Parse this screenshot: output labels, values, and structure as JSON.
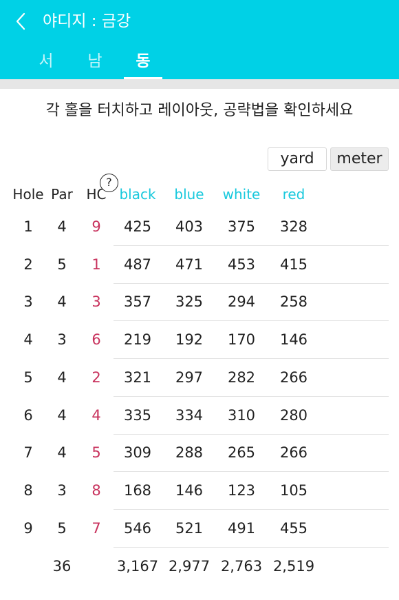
{
  "header": {
    "title": "야디지 : 금강",
    "back_icon": "chevron-left-icon",
    "tabs": [
      {
        "label": "서",
        "active": false
      },
      {
        "label": "남",
        "active": false
      },
      {
        "label": "동",
        "active": true
      }
    ],
    "background_color": "#00d1e6"
  },
  "instruction": "각 홀을 터치하고 레이아웃, 공략법을 확인하세요",
  "units": {
    "yard_label": "yard",
    "meter_label": "meter"
  },
  "table": {
    "columns": {
      "hole": "Hole",
      "par": "Par",
      "hc": "HC",
      "help_icon_label": "?",
      "black": "black",
      "blue": "blue",
      "white": "white",
      "red": "red"
    },
    "rows": [
      {
        "hole": "1",
        "par": "4",
        "hc": "9",
        "black": "425",
        "blue": "403",
        "white": "375",
        "red": "328"
      },
      {
        "hole": "2",
        "par": "5",
        "hc": "1",
        "black": "487",
        "blue": "471",
        "white": "453",
        "red": "415"
      },
      {
        "hole": "3",
        "par": "4",
        "hc": "3",
        "black": "357",
        "blue": "325",
        "white": "294",
        "red": "258"
      },
      {
        "hole": "4",
        "par": "3",
        "hc": "6",
        "black": "219",
        "blue": "192",
        "white": "170",
        "red": "146"
      },
      {
        "hole": "5",
        "par": "4",
        "hc": "2",
        "black": "321",
        "blue": "297",
        "white": "282",
        "red": "266"
      },
      {
        "hole": "6",
        "par": "4",
        "hc": "4",
        "black": "335",
        "blue": "334",
        "white": "310",
        "red": "280"
      },
      {
        "hole": "7",
        "par": "4",
        "hc": "5",
        "black": "309",
        "blue": "288",
        "white": "265",
        "red": "266"
      },
      {
        "hole": "8",
        "par": "3",
        "hc": "8",
        "black": "168",
        "blue": "146",
        "white": "123",
        "red": "105"
      },
      {
        "hole": "9",
        "par": "5",
        "hc": "7",
        "black": "546",
        "blue": "521",
        "white": "491",
        "red": "455"
      }
    ],
    "totals": {
      "par": "36",
      "black": "3,167",
      "blue": "2,977",
      "white": "2,763",
      "red": "2,519"
    }
  },
  "colors": {
    "accent": "#00d1e6",
    "tee_header": "#19c9dd",
    "handicap": "#c8325d"
  }
}
